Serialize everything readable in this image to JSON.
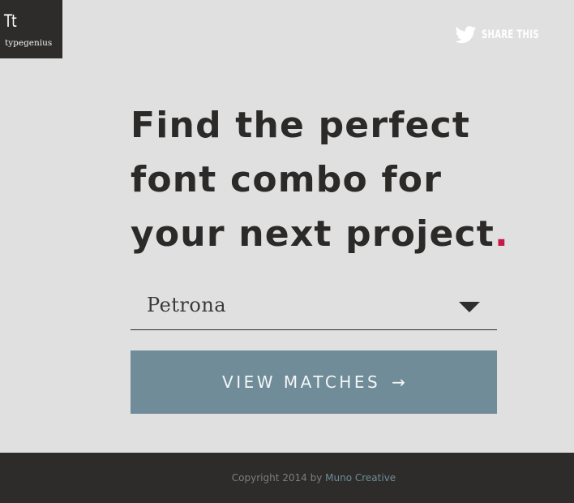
{
  "logo": {
    "mark": "Tt",
    "name": "typegenius"
  },
  "share": {
    "icon": "twitter-bird-icon",
    "label": "SHARE THIS"
  },
  "hero": {
    "lines": [
      "Find the perfect",
      "font combo for",
      "your next project"
    ],
    "end_mark": ".",
    "accent_color": "#c8174a"
  },
  "font_select": {
    "value": "Petrona",
    "icon": "caret-down-icon"
  },
  "cta": {
    "label": "VIEW MATCHES",
    "arrow": "→",
    "background": "#6f8c98"
  },
  "footer": {
    "copyright": "Copyright 2014 by",
    "link": "Muno Creative"
  }
}
